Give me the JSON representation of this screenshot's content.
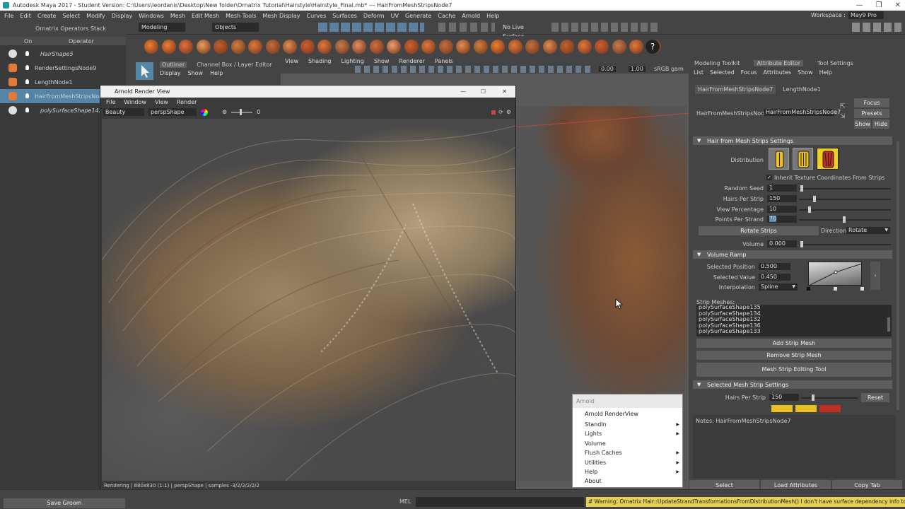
{
  "window": {
    "title": "Autodesk Maya 2017 - Student Version: C:\\Users\\Ieordanis\\Desktop\\New folder\\Ornatrix Tutorial\\Hairstyle\\Hairstyle_Final.mb* --- HairFromMeshStripsNode7"
  },
  "menubar": {
    "items": [
      "File",
      "Edit",
      "Create",
      "Select",
      "Modify",
      "Display",
      "Windows",
      "Mesh",
      "Edit Mesh",
      "Mesh Tools",
      "Mesh Display",
      "Curves",
      "Surfaces",
      "Deform",
      "UV",
      "Generate",
      "Cache",
      "Arnold",
      "Help"
    ],
    "workspace_label": "Workspace :",
    "workspace_value": "May9 Pro"
  },
  "statusline": {
    "mode": "Modeling",
    "objects": "Objects",
    "no_live": "No Live Surface"
  },
  "left_panel": {
    "stack_title": "Ornatrix Operators Stack",
    "col_on": "On",
    "col_operator": "Operator",
    "operators": [
      {
        "label": "HairShape5",
        "italic": true
      },
      {
        "label": "RenderSettingsNode9",
        "italic": false
      },
      {
        "label": "LengthNode1",
        "italic": false
      },
      {
        "label": "HairFromMeshStripsNode7",
        "italic": false,
        "selected": true
      },
      {
        "label": "polySurfaceShape142",
        "italic": true
      }
    ]
  },
  "outliner": {
    "tabs": [
      "Outliner",
      "Channel Box / Layer Editor"
    ],
    "menus": [
      "Display",
      "Show",
      "Help"
    ]
  },
  "viewport": {
    "menus": [
      "View",
      "Shading",
      "Lighting",
      "Show",
      "Renderer",
      "Panels"
    ],
    "exposure": "0.00",
    "gamma": "1.00",
    "colorspace": "sRGB gam"
  },
  "render_view": {
    "title": "Arnold Render View",
    "menus": [
      "File",
      "Window",
      "View",
      "Render"
    ],
    "aov": "Beauty",
    "camera": "perspShape",
    "exposure_value": "0",
    "status": "Rendering | 880x830 (1:1) | perspShape | samples -3/2/2/2/2/2"
  },
  "attribute_editor": {
    "panel_tabs": [
      "Modeling Toolkit",
      "Attribute Editor",
      "Tool Settings"
    ],
    "menus": [
      "List",
      "Selected",
      "Focus",
      "Attributes",
      "Show",
      "Help"
    ],
    "node_tabs": [
      "HairFromMeshStripsNode7",
      "LengthNode1"
    ],
    "node_label": "HairFromMeshStripsNode:",
    "node_value": "HairFromMeshStripsNode7",
    "focus": "Focus",
    "presets": "Presets",
    "show": "Show",
    "hide": "Hide",
    "section_settings": "Hair from Mesh Strips Settings",
    "distribution_label": "Distribution",
    "inherit_label": "Inherit Texture Coordinates From Strips",
    "random_seed_label": "Random Seed",
    "random_seed": "1",
    "hairs_per_strip_label": "Hairs Per Strip",
    "hairs_per_strip": "150",
    "view_percentage_label": "View Percentage",
    "view_percentage": "10",
    "points_per_strand_label": "Points Per Strand",
    "points_per_strand": "70",
    "rotate_strips": "Rotate Strips",
    "direction_label": "Direction",
    "direction_value": "Rotate",
    "volume_label": "Volume",
    "volume_value": "0.000",
    "section_ramp": "Volume Ramp",
    "sel_pos_label": "Selected Position",
    "sel_pos": "0.500",
    "sel_val_label": "Selected Value",
    "sel_val": "0.450",
    "interp_label": "Interpolation",
    "interp_value": "Spline",
    "strip_meshes_label": "Strip Meshes:",
    "strip_meshes": [
      "polySurfaceShape135",
      "polySurfaceShape134",
      "polySurfaceShape132",
      "polySurfaceShape136",
      "polySurfaceShape133"
    ],
    "add_strip": "Add Strip Mesh",
    "remove_strip": "Remove Strip Mesh",
    "strip_tool": "Mesh Strip Editing Tool",
    "section_selected": "Selected Mesh Strip Settings",
    "sel_hairs_label": "Hairs Per Strip",
    "sel_hairs": "150",
    "reset": "Reset",
    "notes": "Notes:  HairFromMeshStripsNode7",
    "select_btn": "Select",
    "load_btn": "Load Attributes",
    "copy_btn": "Copy Tab"
  },
  "arnold_menu": {
    "header": "Arnold",
    "items": [
      {
        "label": "Arnold RenderView",
        "sub": false
      },
      {
        "label": "StandIn",
        "sub": true
      },
      {
        "label": "Lights",
        "sub": true
      },
      {
        "label": "Volume",
        "sub": false
      },
      {
        "label": "Flush Caches",
        "sub": true
      },
      {
        "label": "Utilities",
        "sub": true
      },
      {
        "label": "Help",
        "sub": true
      },
      {
        "label": "About",
        "sub": false
      }
    ]
  },
  "bottom": {
    "save_groom": "Save Groom",
    "mel": "MEL",
    "warning": "# Warning: Ornatrix Hair::UpdateStrandTransformationsFromDistributionMesh() I don't have surface dependency info to wo"
  }
}
